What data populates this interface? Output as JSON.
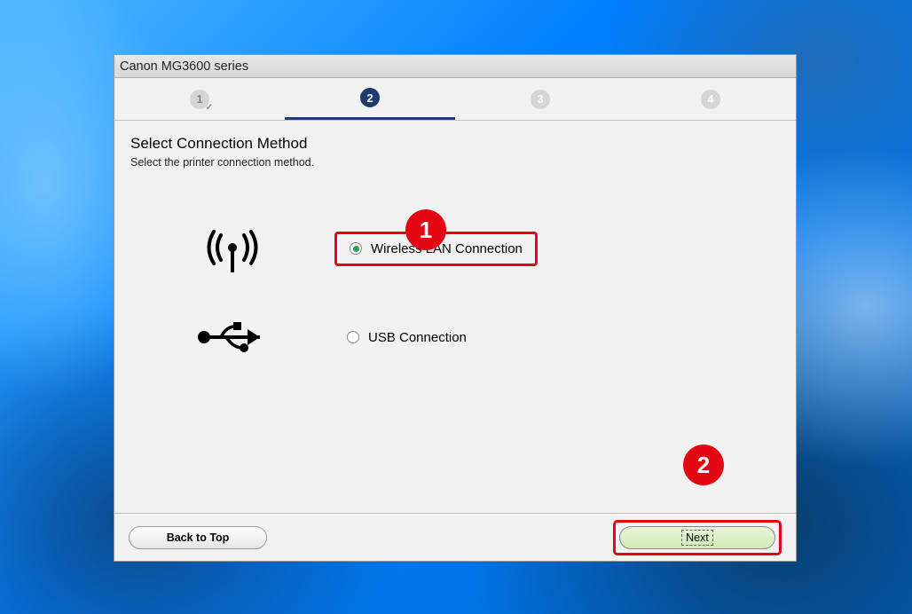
{
  "window": {
    "title": "Canon MG3600 series"
  },
  "steps": {
    "s1": "1",
    "s2": "2",
    "s3": "3",
    "s4": "4"
  },
  "content": {
    "heading": "Select Connection Method",
    "subheading": "Select the printer connection method."
  },
  "options": {
    "wireless": "Wireless LAN Connection",
    "usb": "USB Connection"
  },
  "footer": {
    "back": "Back to Top",
    "next": "Next"
  },
  "callouts": {
    "c1": "1",
    "c2": "2"
  }
}
